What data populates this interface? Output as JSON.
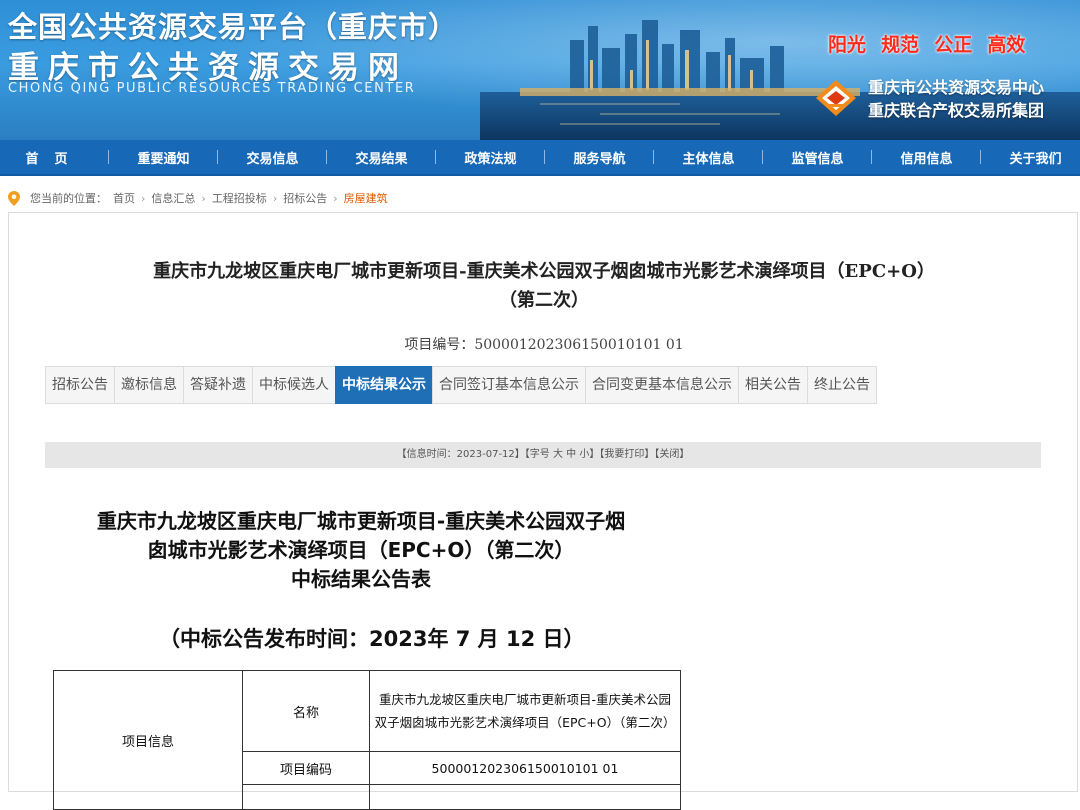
{
  "header": {
    "title": "全国公共资源交易平台（重庆市）",
    "subtitle": "重庆市公共资源交易网",
    "english": "CHONG QING PUBLIC RESOURCES TRADING CENTER",
    "slogans": [
      "阳光",
      "规范",
      "公正",
      "高效"
    ],
    "org_line1": "重庆市公共资源交易中心",
    "org_line2": "重庆联合产权交易所集团",
    "colors": {
      "banner": "#2f8fd6",
      "nav": "#1769b8",
      "slogan": "#ff2a1a"
    }
  },
  "nav": {
    "items": [
      "首页",
      "重要通知",
      "交易信息",
      "交易结果",
      "政策法规",
      "服务导航",
      "主体信息",
      "监管信息",
      "信用信息",
      "关于我们"
    ]
  },
  "breadcrumb": {
    "prefix": "您当前的位置：",
    "items": [
      "首页",
      "信息汇总",
      "工程招投标",
      "招标公告"
    ],
    "current": "房屋建筑",
    "icon": "location-pin-icon"
  },
  "page": {
    "title_line1": "重庆市九龙坡区重庆电厂城市更新项目-重庆美术公园双子烟囱城市光影艺术演绎项目（EPC+O）",
    "title_line2": "（第二次）",
    "project_no_label": "项目编号：",
    "project_no": "500001202306150010101 01"
  },
  "tabs": {
    "items": [
      "招标公告",
      "邀标信息",
      "答疑补遗",
      "中标候选人",
      "中标结果公示",
      "合同签订基本信息公示",
      "合同变更基本信息公示",
      "相关公告",
      "终止公告"
    ],
    "active_index": 4
  },
  "info_bar": {
    "time": "【信息时间：2023-07-12】",
    "font_prefix": "【字号",
    "font_large": "大",
    "font_medium": "中",
    "font_small": "小",
    "font_suffix": "】",
    "print": "【我要打印】",
    "close": "【关闭】"
  },
  "document": {
    "title_line1": "重庆市九龙坡区重庆电厂城市更新项目-重庆美术公园双子烟",
    "title_line2": "囱城市光影艺术演绎项目（EPC+O）（第二次）",
    "title_line3": "中标结果公告表",
    "date": "（中标公告发布时间：2023年 7 月 12 日）"
  },
  "table": {
    "section": "项目信息",
    "rows": [
      {
        "label": "名称",
        "value": "重庆市九龙坡区重庆电厂城市更新项目-重庆美术公园双子烟囱城市光影艺术演绎项目（EPC+O）（第二次）"
      },
      {
        "label": "项目编码",
        "value": "500001202306150010101 01"
      }
    ]
  }
}
